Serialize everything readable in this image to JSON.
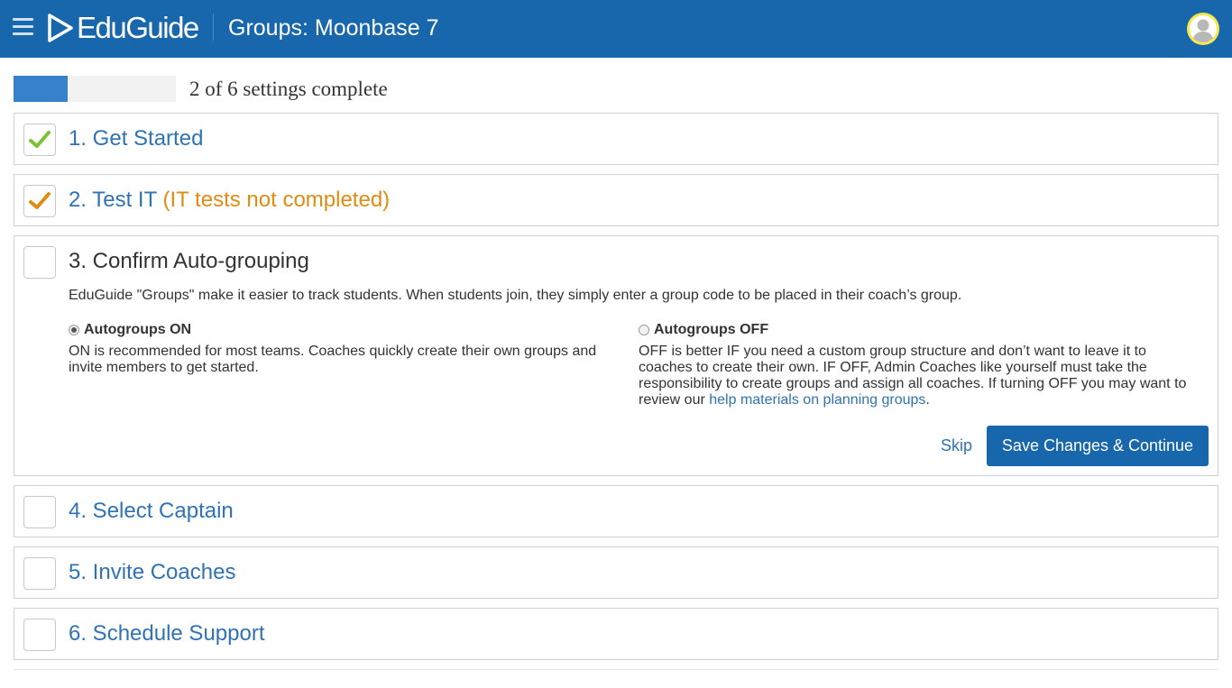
{
  "header": {
    "menu_icon": "hamburger-menu-icon",
    "logo_text": "EduGuide",
    "title": "Groups: Moonbase 7",
    "avatar_icon": "user-avatar-icon",
    "colors": {
      "bar": "#1866ac",
      "avatar_ring": "#f6e84a"
    }
  },
  "progress": {
    "completed": 2,
    "total": 6,
    "fraction": 0.333,
    "label": "2 of 6 settings complete",
    "color": "#3581cc"
  },
  "steps": [
    {
      "title": "1. Get Started",
      "status": "complete",
      "check_icon": "green-check-icon",
      "check_color": "#7ac231"
    },
    {
      "title": "2. Test IT",
      "note": "(IT tests not completed)",
      "status": "warning",
      "check_icon": "orange-check-icon",
      "check_color": "#e08c12"
    },
    {
      "title": "3. Confirm Auto-grouping",
      "status": "open",
      "description": "EduGuide \"Groups\" make it easier to track students. When students join, they simply enter a group code to be placed in their coach’s group.",
      "options": [
        {
          "label": "Autogroups ON",
          "selected": true,
          "text": "ON is recommended for most teams. Coaches quickly create their own groups and invite members to get started."
        },
        {
          "label": "Autogroups OFF",
          "selected": false,
          "text": "OFF is better IF you need a custom group structure and don’t want to leave it to coaches to create their own. IF OFF, Admin Coaches like yourself must take the responsibility to create groups and assign all coaches. If turning OFF you may want to review our ",
          "link_text": "help materials on planning groups",
          "text_end": "."
        }
      ],
      "skip_label": "Skip",
      "save_label": "Save Changes & Continue"
    },
    {
      "title": "4. Select Captain",
      "status": "pending"
    },
    {
      "title": "5. Invite Coaches",
      "status": "pending"
    },
    {
      "title": "6. Schedule Support",
      "status": "pending"
    }
  ]
}
